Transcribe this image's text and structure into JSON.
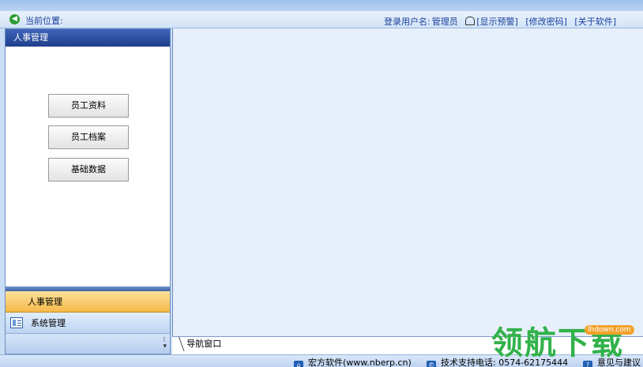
{
  "location": {
    "label": "当前位置:"
  },
  "userbar": {
    "user_label": "登录用户名:",
    "user_name": "管理员",
    "show_alert": "[显示预警]",
    "change_password": "[修改密码]",
    "about": "[关于软件]"
  },
  "sidebar": {
    "header": "人事管理",
    "buttons": [
      "员工资料",
      "员工档案",
      "基础数据"
    ],
    "nav_active": "人事管理",
    "nav_item": "系统管理"
  },
  "tabs": {
    "nav_window": "导航窗口"
  },
  "status": {
    "company": "宏方软件(www.nberp.cn)",
    "support": "技术支持电话: 0574-62175444",
    "feedback": "意见与建议"
  },
  "watermark": {
    "text": "领航下载",
    "badge": "lhdown.com"
  },
  "colors": {
    "header_blue": "#1e3f8c",
    "active_orange": "#f5b94a",
    "watermark_green": "#31b24a"
  }
}
